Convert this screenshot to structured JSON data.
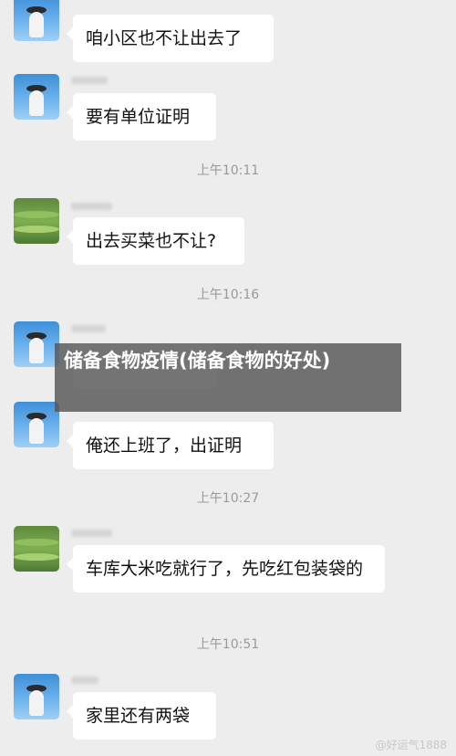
{
  "messages": [
    {
      "text": "咱小区也不让出去了"
    },
    {
      "text": "要有单位证明"
    },
    {
      "text": "出去买菜也不让?"
    },
    {
      "text": "俺还上班了，出证明"
    },
    {
      "text": "车库大米吃就行了，先吃红包装袋的"
    },
    {
      "text": "家里还有两袋"
    }
  ],
  "timestamps": [
    "上午10:11",
    "上午10:16",
    "上午10:27",
    "上午10:51"
  ],
  "overlay": {
    "title": "储备食物疫情(储备食物的好处)"
  },
  "watermark": "@好运气1888",
  "colors": {
    "background": "#ededed",
    "bubble": "#ffffff",
    "overlay": "#555555"
  }
}
